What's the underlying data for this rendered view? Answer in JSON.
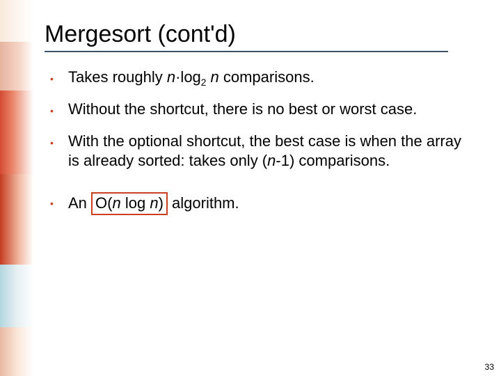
{
  "title": "Mergesort (cont'd)",
  "bullets": [
    {
      "pre": "Takes roughly ",
      "n1": "n",
      "mid": "·log",
      "sub": "2",
      "sp": " ",
      "n2": "n",
      "post": " comparisons."
    },
    {
      "text": "Without the shortcut, there is no best or worst case."
    },
    {
      "pre": "With the optional shortcut, the best case is when the array is already sorted: takes only (",
      "n1": "n",
      "post": "-1) comparisons."
    },
    {
      "pre": "An ",
      "box_pre": "O(",
      "box_n1": "n",
      "box_mid": " log ",
      "box_n2": "n",
      "box_post": ")",
      "post": " algorithm."
    }
  ],
  "page_number": "33"
}
